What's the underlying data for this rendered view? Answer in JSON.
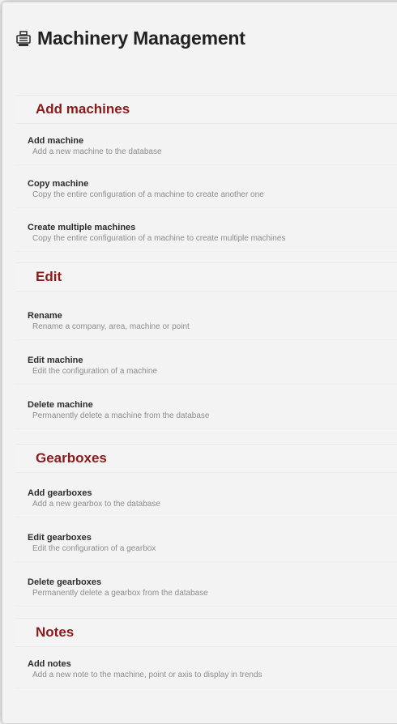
{
  "header": {
    "title": "Machinery Management",
    "icon": "machine-icon"
  },
  "colors": {
    "section_title": "#8b1a1a",
    "item_title": "#2c2c2c",
    "item_desc": "#8d8d8d"
  },
  "sections": [
    {
      "title": "Add machines",
      "items": [
        {
          "title": "Add machine",
          "desc": "Add a new machine to the database"
        },
        {
          "title": "Copy machine",
          "desc": "Copy the entire configuration of a machine to create another one"
        },
        {
          "title": "Create multiple machines",
          "desc": "Copy the entire configuration of a machine to create multiple machines"
        }
      ]
    },
    {
      "title": "Edit",
      "items": [
        {
          "title": "Rename",
          "desc": "Rename a company, area, machine or point"
        },
        {
          "title": "Edit machine",
          "desc": "Edit the configuration of a machine"
        },
        {
          "title": "Delete machine",
          "desc": "Permanently delete a machine from the database"
        }
      ]
    },
    {
      "title": "Gearboxes",
      "items": [
        {
          "title": "Add gearboxes",
          "desc": "Add a new gearbox to the database"
        },
        {
          "title": "Edit gearboxes",
          "desc": "Edit the configuration of a gearbox"
        },
        {
          "title": "Delete gearboxes",
          "desc": "Permanently delete a gearbox from the database"
        }
      ]
    },
    {
      "title": "Notes",
      "items": [
        {
          "title": "Add notes",
          "desc": "Add a new note to the machine, point or axis to display in trends"
        }
      ]
    }
  ]
}
